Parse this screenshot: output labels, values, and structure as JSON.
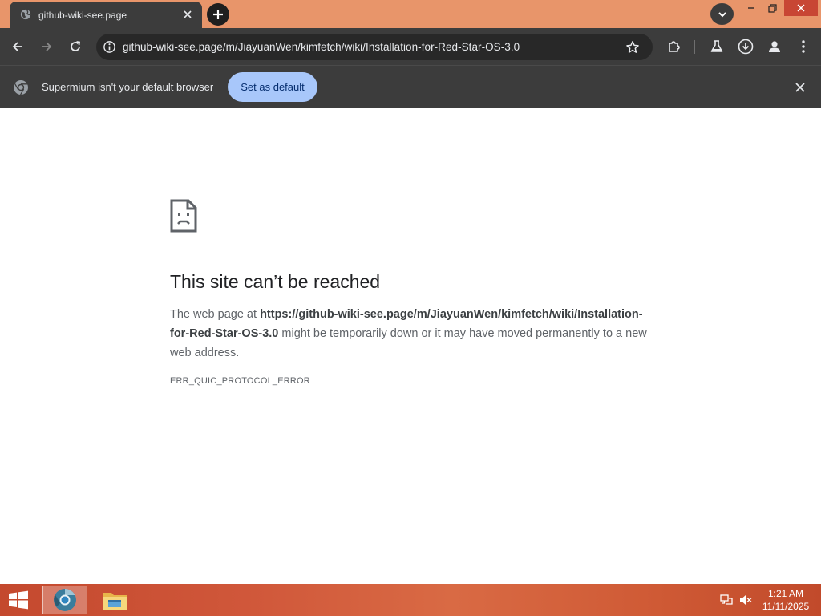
{
  "browser": {
    "tab": {
      "title": "github-wiki-see.page"
    },
    "omnibox": {
      "url": "github-wiki-see.page/m/JiayuanWen/kimfetch/wiki/Installation-for-Red-Star-OS-3.0"
    },
    "infobar": {
      "message": "Supermium isn't your default browser",
      "button_label": "Set as default"
    }
  },
  "error_page": {
    "title": "This site can’t be reached",
    "body_prefix": "The web page at ",
    "body_url": "https://github-wiki-see.page/m/JiayuanWen/kimfetch/wiki/Installation-for-Red-Star-OS-3.0",
    "body_suffix": " might be temporarily down or it may have moved permanently to a new web address.",
    "error_code": "ERR_QUIC_PROTOCOL_ERROR"
  },
  "taskbar": {
    "time": "1:21 AM",
    "date": "11/11/2025"
  },
  "colors": {
    "titlebar": "#e8956a",
    "toolbar": "#3c3c3c",
    "accent_button": "#a8c7fa",
    "close_red": "#c84634"
  },
  "icons": [
    "globe-icon",
    "tab-close-icon",
    "plus-icon",
    "chevron-down-icon",
    "minimize-icon",
    "restore-icon",
    "window-close-icon",
    "back-arrow-icon",
    "forward-arrow-icon",
    "reload-icon",
    "info-icon",
    "star-icon",
    "extensions-icon",
    "labs-flask-icon",
    "download-icon",
    "profile-icon",
    "kebab-menu-icon",
    "chrome-logo-icon",
    "close-icon",
    "sad-page-icon",
    "windows-logo-icon",
    "browser-app-icon",
    "folder-icon",
    "network-icon",
    "speaker-muted-icon"
  ]
}
